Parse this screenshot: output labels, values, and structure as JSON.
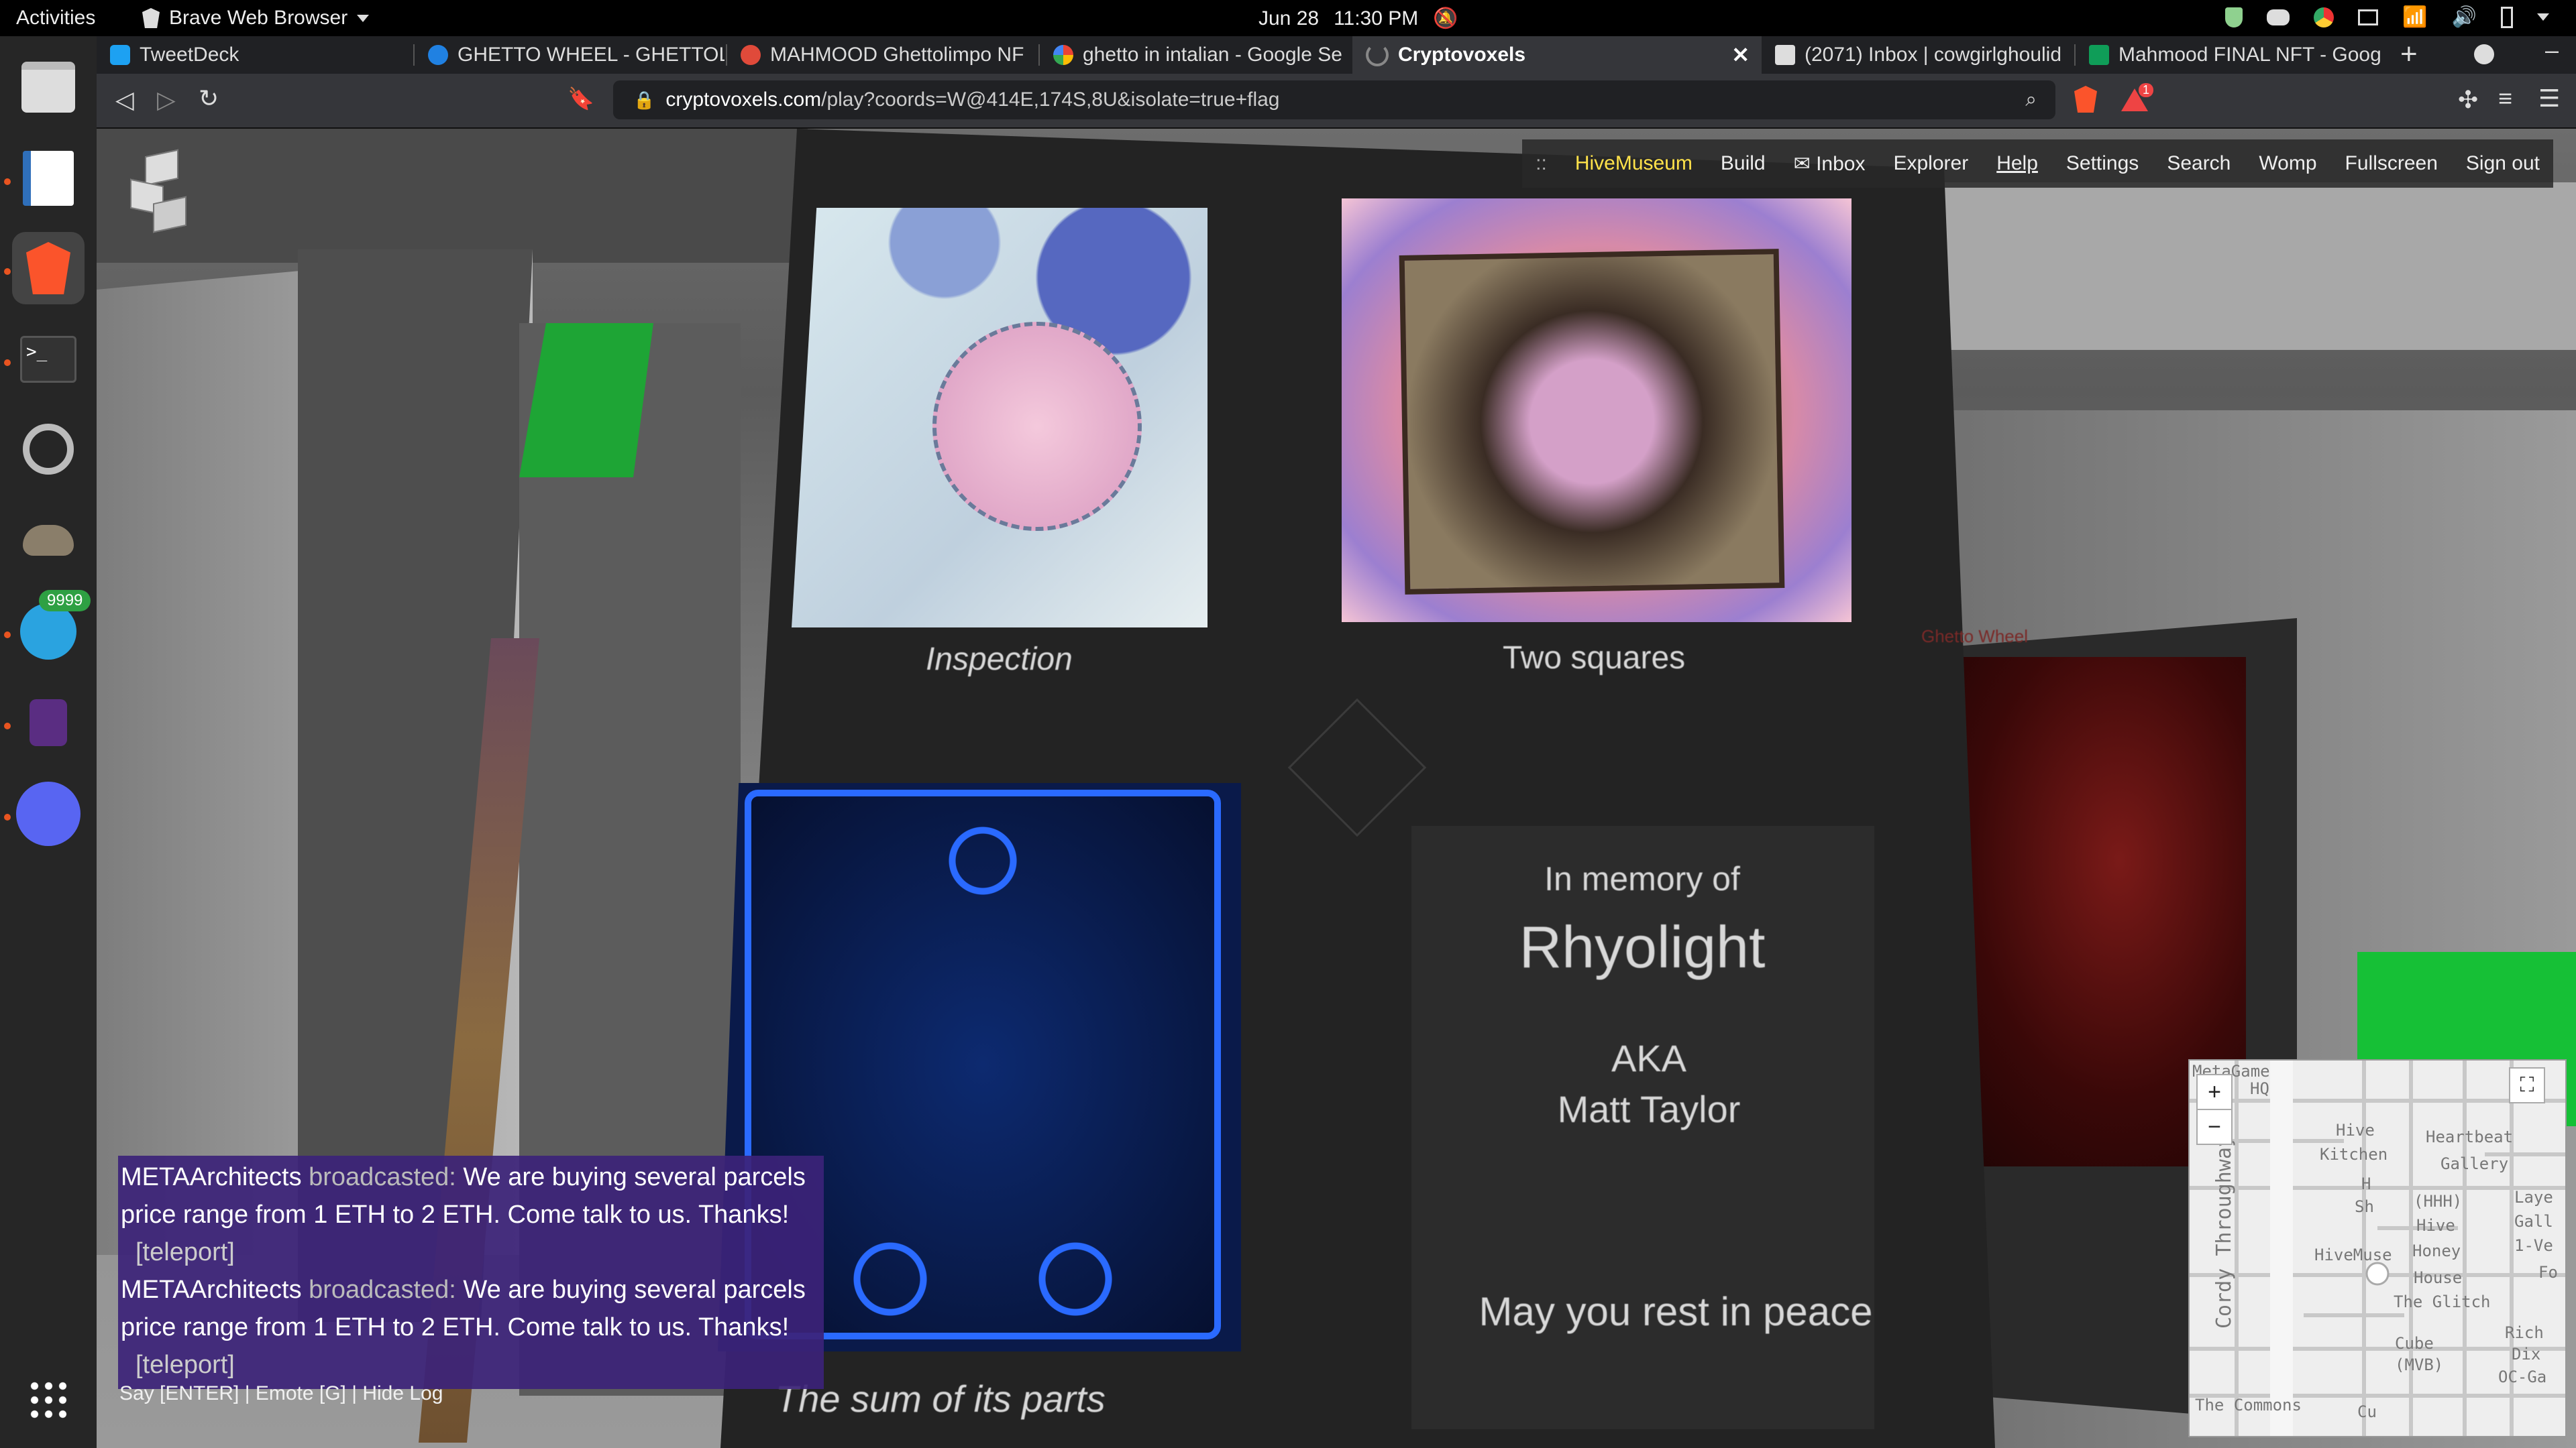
{
  "topbar": {
    "activities": "Activities",
    "app_name": "Brave Web Browser",
    "date": "Jun 28",
    "time": "11:30 PM"
  },
  "dock": {
    "telegram_badge": "9999",
    "items": [
      "files-icon",
      "writer-icon",
      "brave-icon",
      "terminal-icon",
      "settings-icon",
      "gimp-icon",
      "telegram-icon",
      "game-icon",
      "discord-icon",
      "apps-grid-icon"
    ]
  },
  "tabs": [
    {
      "label": "TweetDeck",
      "color": "#1da1f2"
    },
    {
      "label": "GHETTO WHEEL - GHETTOLI",
      "color": "#2081e2"
    },
    {
      "label": "MAHMOOD Ghettolimpo NF",
      "color": "#e04a3a"
    },
    {
      "label": "ghetto in intalian - Google Se",
      "color": "#ffffff"
    },
    {
      "label": "Cryptovoxels",
      "color": "#888888"
    },
    {
      "label": "(2071) Inbox | cowgirlghoulid",
      "color": "#dddddd"
    },
    {
      "label": "Mahmood FINAL NFT - Goog",
      "color": "#0f9d58"
    }
  ],
  "toolbar": {
    "url_host": "cryptovoxels.com",
    "url_path": "/play?coords=W@414E,174S,8U&isolate=true+flag",
    "brave_alert": "1"
  },
  "menu": {
    "handle": "::",
    "museum": "HiveMuseum",
    "build": "Build",
    "inbox": "✉ Inbox",
    "explorer": "Explorer",
    "help": "Help",
    "settings": "Settings",
    "search": "Search",
    "womp": "Womp",
    "fullscreen": "Fullscreen",
    "sign_out": "Sign out"
  },
  "artworks": {
    "caption1": "Inspection",
    "caption2": "Two squares",
    "caption3": "The sum of its parts",
    "right_wall_sign": "Ghetto Wheel"
  },
  "memorial": {
    "line1": "In memory of",
    "name": "Rhyolight",
    "aka": "AKA",
    "real_name": "Matt Taylor",
    "farewell": "May you rest in peace"
  },
  "chat": {
    "messages": [
      {
        "sender": "METAArchitects",
        "verb": "broadcasted:",
        "text": "We are buying several parcels price range from 1 ETH to 2 ETH. Come talk to us. Thanks!",
        "link": "[teleport]"
      },
      {
        "sender": "METAArchitects",
        "verb": "broadcasted:",
        "text": "We are buying several parcels price range from 1 ETH to 2 ETH. Come talk to us. Thanks!",
        "link": "[teleport]"
      }
    ],
    "hint": "Say [ENTER] | Emote [G] | Hide Log"
  },
  "minimap": {
    "zoom_in": "+",
    "zoom_out": "−",
    "labels": [
      "MetaGame",
      "HQ",
      "Hive",
      "Kitchen",
      "Heartbeat",
      "Gallery",
      "H",
      "Sh",
      "(HHH)",
      "Hive",
      "Honey",
      "House",
      "Laye",
      "Gall",
      "1-Ve",
      "Fo",
      "HiveMuse",
      "The Glitch",
      "Cube",
      "(MVB)",
      "Rich",
      "Dix",
      "OC-Ga",
      "The Commons",
      "Cordy Throughway",
      "Cu"
    ]
  }
}
